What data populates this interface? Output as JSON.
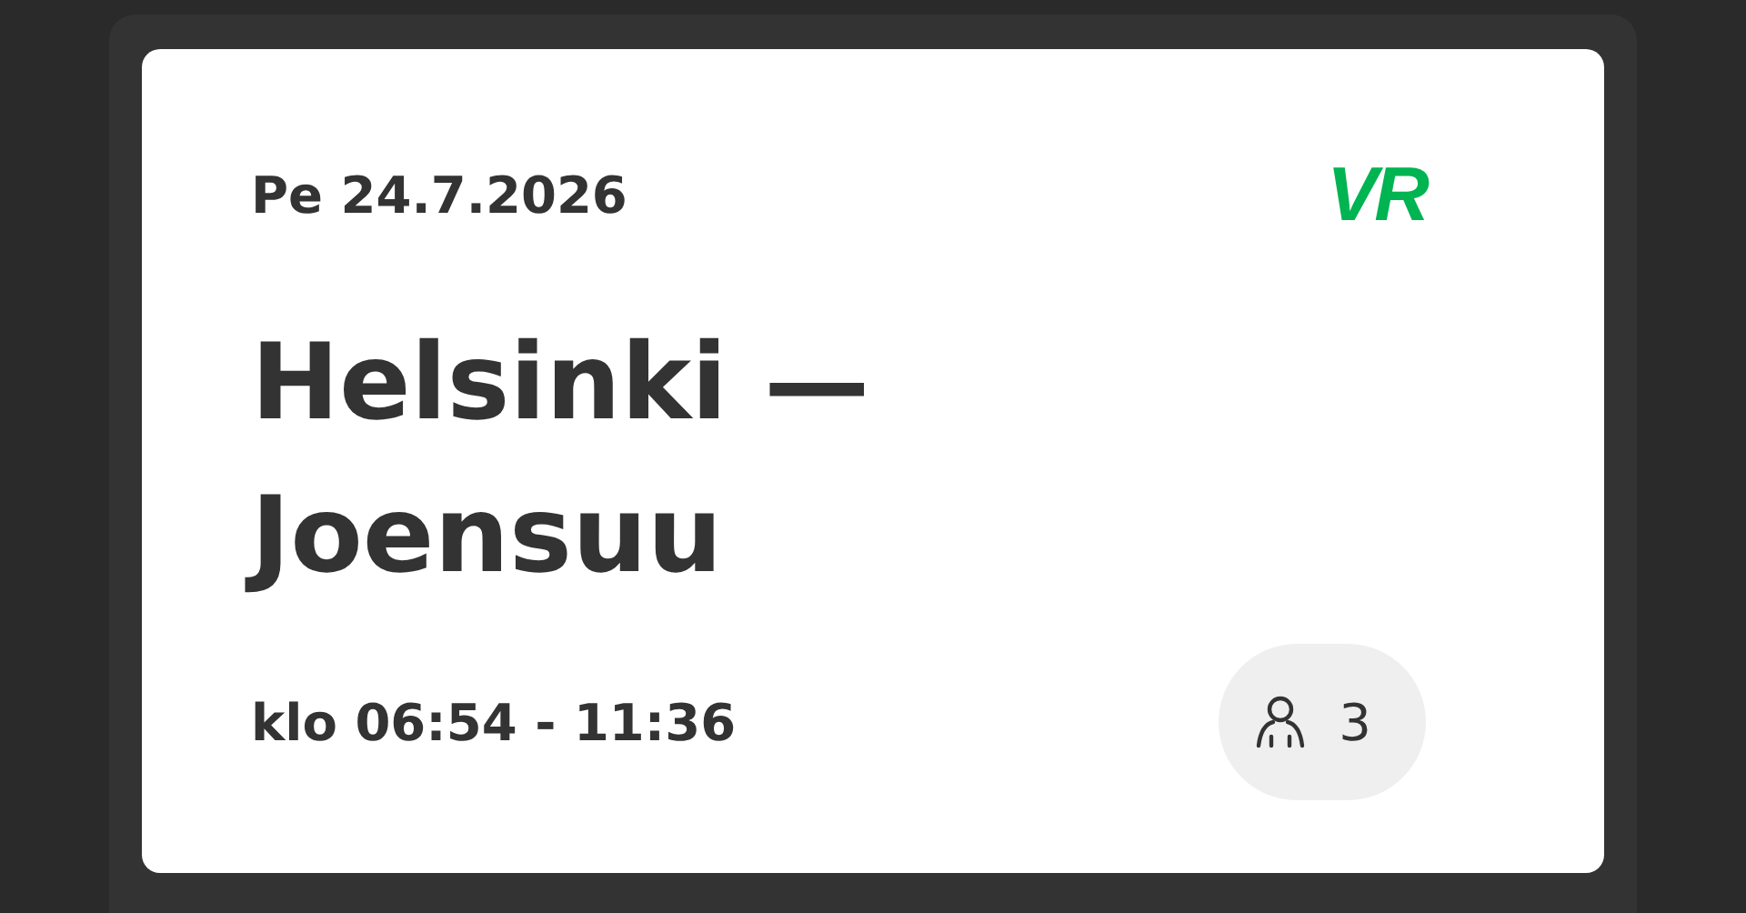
{
  "date": "Pe 24.7.2026",
  "logo": "VR",
  "route": "Helsinki — Joensuu",
  "time": "klo 06:54 - 11:36",
  "passengers": "3"
}
